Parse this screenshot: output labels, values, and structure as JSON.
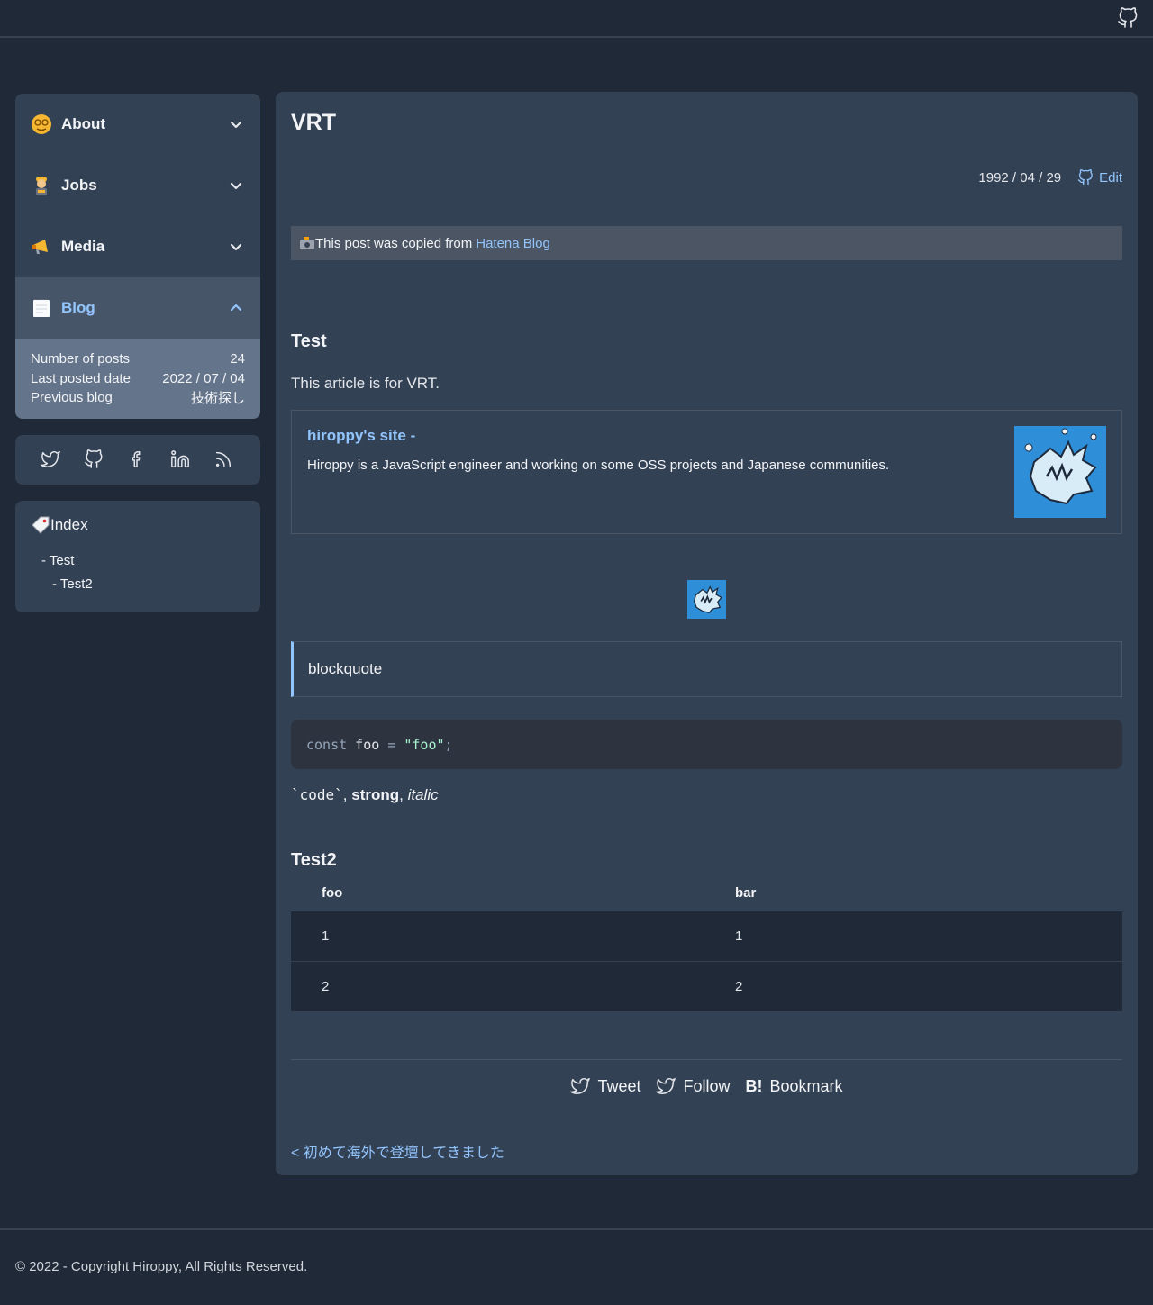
{
  "header": {
    "github_icon": "github-icon"
  },
  "sidebar": {
    "items": [
      {
        "label": "About",
        "icon": "smiley-icon",
        "expanded": false
      },
      {
        "label": "Jobs",
        "icon": "worker-icon",
        "expanded": false
      },
      {
        "label": "Media",
        "icon": "megaphone-icon",
        "expanded": false
      },
      {
        "label": "Blog",
        "icon": "notepad-icon",
        "expanded": true
      }
    ],
    "blog_stats": [
      {
        "label": "Number of posts",
        "value": "24"
      },
      {
        "label": "Last posted date",
        "value": "2022 / 07 / 04"
      },
      {
        "label": "Previous blog",
        "value": "技術探し"
      }
    ],
    "social": [
      "twitter-icon",
      "github-icon",
      "facebook-icon",
      "linkedin-icon",
      "rss-icon"
    ],
    "index": {
      "title": "Index",
      "items": [
        "- Test",
        "- Test2"
      ]
    }
  },
  "article": {
    "title": "VRT",
    "date": "1992 / 04 / 29",
    "edit_label": "Edit",
    "note_prefix": "This post was copied from ",
    "note_link": "Hatena Blog",
    "h2_test": "Test",
    "paragraph": "This article is for VRT.",
    "card": {
      "title": "hiroppy's site -",
      "description": "Hiroppy is a JavaScript engineer and working on some OSS projects and Japanese communities."
    },
    "blockquote": "blockquote",
    "code": {
      "keyword": "const",
      "name": " foo ",
      "op": "= ",
      "string": "\"foo\"",
      "end": ";"
    },
    "inline": {
      "code": "`code`",
      "sep1": ", ",
      "strong": "strong",
      "sep2": ", ",
      "italic": "italic"
    },
    "h2_test2": "Test2",
    "table": {
      "headers": [
        "foo",
        "bar"
      ],
      "rows": [
        [
          "1",
          "1"
        ],
        [
          "2",
          "2"
        ]
      ]
    },
    "share": {
      "tweet": "Tweet",
      "follow": "Follow",
      "bookmark_mark": "B!",
      "bookmark": "Bookmark"
    },
    "prev_link": "< 初めて海外で登壇してきました"
  },
  "footer": {
    "copyright": "© 2022 - Copyright Hiroppy, All Rights Reserved."
  },
  "colors": {
    "accent": "#93c5fd",
    "background": "#1f2937",
    "panel": "#334155"
  }
}
